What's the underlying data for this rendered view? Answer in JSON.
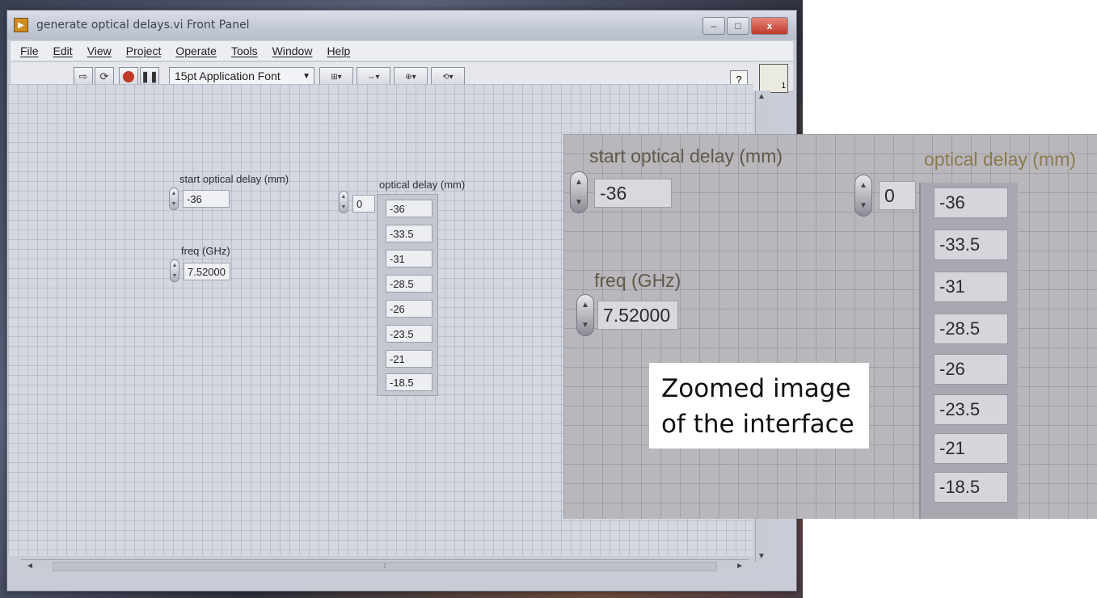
{
  "window": {
    "title": "generate optical delays.vi Front Panel",
    "controls": {
      "minimize": "–",
      "maximize": "□",
      "close": "x"
    }
  },
  "menu": [
    "File",
    "Edit",
    "View",
    "Project",
    "Operate",
    "Tools",
    "Window",
    "Help"
  ],
  "toolbar": {
    "run_icon": "run-arrow-icon",
    "run_continuous_icon": "run-continuously-icon",
    "abort_icon": "abort-stop-icon",
    "pause_icon": "pause-icon",
    "font_select": "15pt Application Font",
    "align_icon": "align-objects-icon",
    "distribute_icon": "distribute-objects-icon",
    "resize_icon": "resize-objects-icon",
    "reorder_icon": "reorder-icon",
    "help_label": "?",
    "vi_icon_number": "1"
  },
  "panel": {
    "start_delay": {
      "label": "start optical delay (mm)",
      "value": "-36"
    },
    "freq": {
      "label": "freq (GHz)",
      "value": "7.52000"
    },
    "optical_delay": {
      "label": "optical delay (mm)",
      "index": "0",
      "values": [
        "-36",
        "-33.5",
        "-31",
        "-28.5",
        "-26",
        "-23.5",
        "-21",
        "-18.5"
      ]
    }
  },
  "zoom": {
    "caption_line1": "Zoomed image",
    "caption_line2": "of the interface"
  }
}
